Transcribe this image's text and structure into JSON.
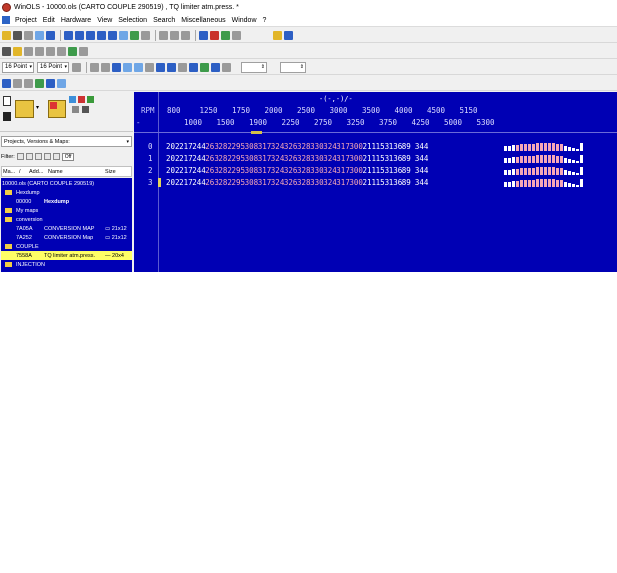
{
  "window": {
    "title": "WinOLS - 10000.ols (CARTO COUPLE 290519) , TQ limiter atm.press. *"
  },
  "menu": [
    "Project",
    "Edit",
    "Hardware",
    "View",
    "Selection",
    "Search",
    "Miscellaneous",
    "Window",
    "?"
  ],
  "toolbar3": {
    "font1": "16 Point",
    "font2": "16 Point"
  },
  "left_panel": {
    "selector": "Projects, Versions & Maps:",
    "filter_label": "Filter:",
    "filter_off": "Off",
    "columns": [
      "Ma...",
      "/",
      "Add...",
      "Name",
      "Size"
    ],
    "tree": [
      {
        "type": "root",
        "label": "10000.ols (CARTO COUPLE 290519)"
      },
      {
        "type": "folder",
        "label": "Hexdump"
      },
      {
        "type": "map",
        "addr": "00000",
        "name": "Hexdump",
        "size": ""
      },
      {
        "type": "folder",
        "label": "My maps"
      },
      {
        "type": "folder",
        "label": "conversion"
      },
      {
        "type": "map",
        "addr": "7A05A",
        "name": "CONVERSION MAP",
        "size": "21x12"
      },
      {
        "type": "map",
        "addr": "7A252",
        "name": "CONVERSION Map",
        "size": "21x12"
      },
      {
        "type": "folder",
        "label": "COUPLE"
      },
      {
        "type": "map",
        "addr": "7558A",
        "name": "TQ limiter atm.press.",
        "size": "20x4",
        "selected": true
      },
      {
        "type": "folder",
        "label": "INJECTION"
      }
    ]
  },
  "hexview": {
    "header": "-(-,-)/-",
    "rpm_label": "RPM",
    "row_dash": "-",
    "x_top": [
      "800",
      "1250",
      "1750",
      "2000",
      "2500",
      "3000",
      "3500",
      "4000",
      "4500",
      "5150"
    ],
    "x_bottom": [
      "1000",
      "1500",
      "1900",
      "2250",
      "2750",
      "3250",
      "3750",
      "4250",
      "5000",
      "5300"
    ],
    "rows": [
      {
        "index": "0",
        "values": [
          "202",
          "217",
          "244",
          "263",
          "282",
          "295",
          "308",
          "317",
          "324",
          "326",
          "328",
          "330",
          "324",
          "317",
          "300",
          "211",
          "153",
          "136",
          "89",
          "344"
        ]
      },
      {
        "index": "1",
        "values": [
          "202",
          "217",
          "244",
          "263",
          "282",
          "295",
          "308",
          "317",
          "324",
          "326",
          "328",
          "330",
          "324",
          "317",
          "300",
          "211",
          "153",
          "136",
          "89",
          "344"
        ]
      },
      {
        "index": "2",
        "values": [
          "202",
          "217",
          "244",
          "263",
          "282",
          "295",
          "308",
          "317",
          "324",
          "326",
          "328",
          "330",
          "324",
          "317",
          "300",
          "211",
          "153",
          "136",
          "89",
          "344"
        ]
      },
      {
        "index": "3",
        "values": [
          "202",
          "217",
          "244",
          "263",
          "282",
          "295",
          "308",
          "317",
          "324",
          "326",
          "328",
          "330",
          "324",
          "317",
          "300",
          "211",
          "153",
          "136",
          "89",
          "344"
        ]
      }
    ],
    "pink_from": 3,
    "pink_to": 14,
    "colors": {
      "background": "#0000b4",
      "normal": "#ffffff",
      "highlight": "#f5a7b7"
    }
  }
}
